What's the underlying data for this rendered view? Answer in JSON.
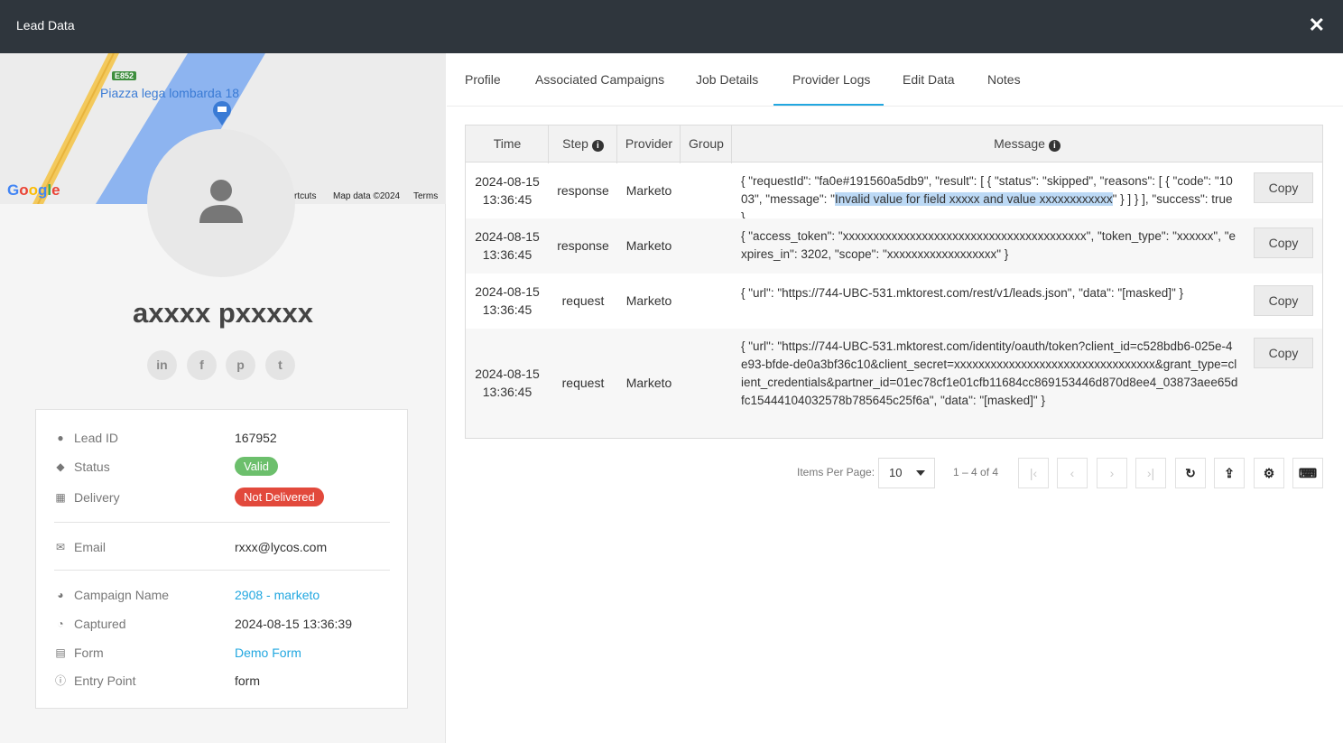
{
  "window": {
    "title": "Lead Data",
    "close_glyph": "✕"
  },
  "map": {
    "place": "Piazza lega lombarda 18",
    "road_shield": "E852",
    "shortcuts": "rtcuts",
    "map_data": "Map data ©2024",
    "terms": "Terms",
    "google_letters": [
      "G",
      "o",
      "o",
      "g",
      "l",
      "e"
    ],
    "google_colors": [
      "#4285F4",
      "#EA4335",
      "#FBBC05",
      "#4285F4",
      "#34A853",
      "#EA4335"
    ]
  },
  "profile": {
    "name": "axxxx pxxxxx",
    "socials": [
      {
        "icon": "linkedin-icon",
        "glyph": "in"
      },
      {
        "icon": "facebook-icon",
        "glyph": "f"
      },
      {
        "icon": "pinterest-icon",
        "glyph": "p"
      },
      {
        "icon": "twitter-icon",
        "glyph": "t"
      }
    ]
  },
  "details": {
    "lead_id": {
      "label": "Lead ID",
      "value": "167952"
    },
    "status": {
      "label": "Status",
      "value": "Valid",
      "color": "#6cbf6c"
    },
    "delivery": {
      "label": "Delivery",
      "value": "Not Delivered",
      "color": "#e2493c"
    },
    "email": {
      "label": "Email",
      "value": "rxxx@lycos.com"
    },
    "campaign": {
      "label": "Campaign Name",
      "value": "2908 - marketo"
    },
    "captured": {
      "label": "Captured",
      "value": "2024-08-15 13:36:39"
    },
    "form": {
      "label": "Form",
      "value": "Demo Form"
    },
    "entry_point": {
      "label": "Entry Point",
      "value": "form"
    }
  },
  "tabs": [
    "Profile",
    "Associated Campaigns",
    "Job Details",
    "Provider Logs",
    "Edit Data",
    "Notes"
  ],
  "active_tab": "Provider Logs",
  "table": {
    "headers": {
      "time": "Time",
      "step": "Step",
      "provider": "Provider",
      "group": "Group",
      "message": "Message"
    },
    "copy_label": "Copy",
    "rows": [
      {
        "date": "2024-08-15",
        "time": "13:36:45",
        "step": "response",
        "provider": "Marketo",
        "group": "",
        "msg_pre": "{ \"requestId\": \"fa0e#191560a5db9\", \"result\": [ { \"status\": \"skipped\", \"reasons\": [ { \"code\": \"1003\", \"message\": \"",
        "msg_hl": "Invalid value for field xxxxx and value xxxxxxxxxxxx",
        "msg_post": "\" } ] } ], \"success\": true }"
      },
      {
        "date": "2024-08-15",
        "time": "13:36:45",
        "step": "response",
        "provider": "Marketo",
        "group": "",
        "msg": "{ \"access_token\": \"xxxxxxxxxxxxxxxxxxxxxxxxxxxxxxxxxxxxxxxx\", \"token_type\": \"xxxxxx\", \"expires_in\": 3202, \"scope\": \"xxxxxxxxxxxxxxxxxx\" }"
      },
      {
        "date": "2024-08-15",
        "time": "13:36:45",
        "step": "request",
        "provider": "Marketo",
        "group": "",
        "msg": "{ \"url\": \"https://744-UBC-531.mktorest.com/rest/v1/leads.json\", \"data\": \"[masked]\" }"
      },
      {
        "date": "2024-08-15",
        "time": "13:36:45",
        "step": "request",
        "provider": "Marketo",
        "group": "",
        "msg": "{ \"url\": \"https://744-UBC-531.mktorest.com/identity/oauth/token?client_id=c528bdb6-025e-4e93-bfde-de0a3bf36c10&client_secret=xxxxxxxxxxxxxxxxxxxxxxxxxxxxxxxxx&grant_type=client_credentials&partner_id=01ec78cf1e01cfb11684cc869153446d870d8ee4_03873aee65dfc15444104032578b785645c25f6a\", \"data\": \"[masked]\" }"
      }
    ]
  },
  "pager": {
    "items_per_page_label": "Items Per Page:",
    "items_per_page": "10",
    "range": "1 – 4 of 4",
    "buttons": {
      "first": "|‹",
      "prev": "‹",
      "next": "›",
      "last": "›|",
      "refresh": "↻",
      "download": "⇪",
      "settings": "⚙",
      "keyboard": "⌨"
    }
  },
  "colors": {
    "accent": "#22a7e0",
    "titlebar": "#2f363d"
  }
}
